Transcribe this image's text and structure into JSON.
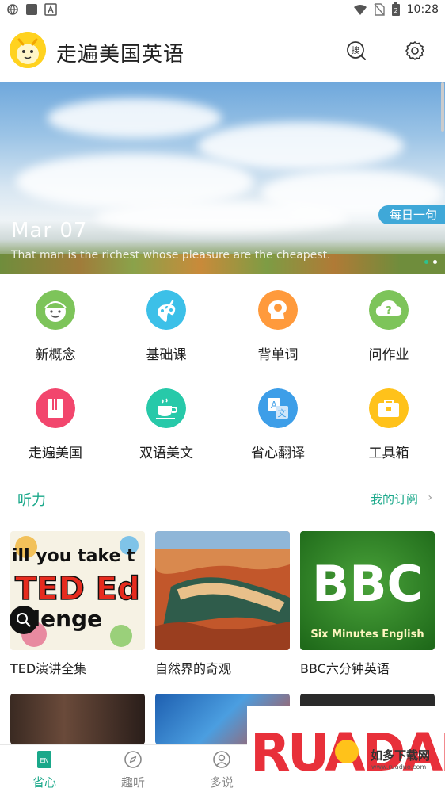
{
  "status_bar": {
    "time": "10:28",
    "battery_level": "2"
  },
  "app": {
    "title": "走遍美国英语"
  },
  "banner": {
    "date": "Mar 07",
    "quote": "That man is the richest whose pleasure are the cheapest.",
    "tag": "每日一句"
  },
  "grid": [
    {
      "label": "新概念",
      "icon": "smiley-face-icon",
      "color": "#7dc45a"
    },
    {
      "label": "基础课",
      "icon": "paint-palette-icon",
      "color": "#3cc0e8"
    },
    {
      "label": "背单词",
      "icon": "brain-head-icon",
      "color": "#ff9a3c"
    },
    {
      "label": "问作业",
      "icon": "question-cloud-icon",
      "color": "#7dc45a"
    },
    {
      "label": "走遍美国",
      "icon": "book-icon",
      "color": "#f2466d"
    },
    {
      "label": "双语美文",
      "icon": "coffee-cup-icon",
      "color": "#27c9a9"
    },
    {
      "label": "省心翻译",
      "icon": "translate-icon",
      "color": "#3d9ee8"
    },
    {
      "label": "工具箱",
      "icon": "toolbox-icon",
      "color": "#ffc21a"
    }
  ],
  "section": {
    "title": "听力",
    "link": "我的订阅"
  },
  "cards": [
    {
      "label": "TED演讲全集",
      "image_text": [
        "ill you take t",
        "TED Ed",
        "allenge"
      ]
    },
    {
      "label": "自然界的奇观"
    },
    {
      "label": "BBC六分钟英语",
      "image_text": [
        "BBC",
        "Six Minutes English"
      ]
    }
  ],
  "bottom_nav": [
    {
      "label": "省心",
      "icon": "en-book-icon",
      "badge": "EN"
    },
    {
      "label": "趣听",
      "icon": "compass-icon"
    },
    {
      "label": "多说",
      "icon": "user-icon"
    }
  ],
  "watermark": {
    "logo": "RUADADO",
    "cn": "如多下载网",
    "url": "www.ruaduo.com"
  },
  "colors": {
    "accent": "#1aa88a",
    "tag": "#3fa8d8"
  }
}
